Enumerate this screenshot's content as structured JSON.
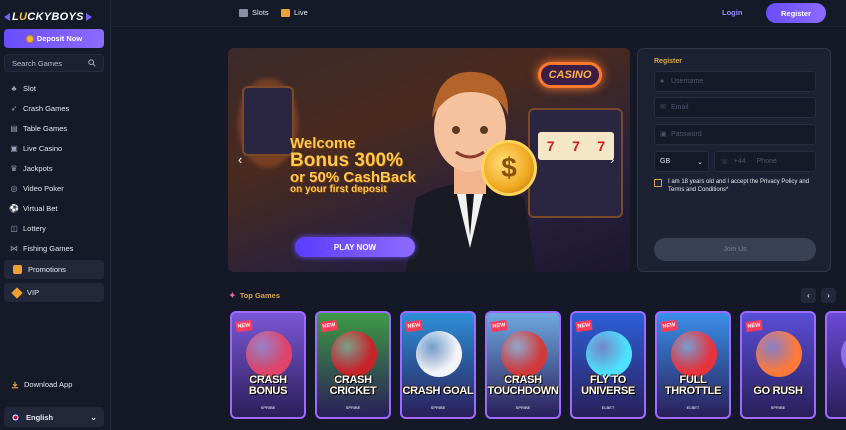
{
  "sidebar": {
    "logo_pre": "L",
    "logo_accent": "U",
    "logo_rest": "CKYBOYS",
    "deposit_label": "Deposit Now",
    "search_placeholder": "Search Games",
    "items": [
      {
        "label": "Slot",
        "icon": "cherry-icon"
      },
      {
        "label": "Crash Games",
        "icon": "rocket-icon"
      },
      {
        "label": "Table Games",
        "icon": "table-icon"
      },
      {
        "label": "Live Casino",
        "icon": "cards-icon"
      },
      {
        "label": "Jackpots",
        "icon": "trophy-icon"
      },
      {
        "label": "Video Poker",
        "icon": "chip-icon"
      },
      {
        "label": "Virtual Bet",
        "icon": "ball-icon"
      },
      {
        "label": "Lottery",
        "icon": "ticket-icon"
      },
      {
        "label": "Fishing Games",
        "icon": "fish-icon"
      }
    ],
    "promotions_label": "Promotions",
    "vip_label": "VIP",
    "download_label": "Download App",
    "language_label": "English"
  },
  "topbar": {
    "tab_slots": "Slots",
    "tab_live": "Live",
    "login_label": "Login",
    "register_label": "Register"
  },
  "banner": {
    "sign": "CASINO",
    "line1": "Welcome",
    "line2": "Bonus 300%",
    "line3": "or 50% CashBack",
    "line4": "on your first deposit",
    "coin_symbol": "$",
    "play_label": "PLAY NOW"
  },
  "register_form": {
    "title": "Register",
    "username_placeholder": "Username",
    "email_placeholder": "Email",
    "password_placeholder": "Password",
    "country_value": "GB",
    "phone_code": "+44",
    "phone_placeholder": "Phone",
    "agree_text": "I am 18 years old and I accept the Privacy Policy and Terms and Conditions*",
    "join_label": "Join Us"
  },
  "top_games": {
    "title": "Top Games",
    "badge": "NEW",
    "games": [
      {
        "name": "CRASH BONUS",
        "brand": "SPRIBE",
        "bg": "#7b57d6",
        "art": "#e0426a"
      },
      {
        "name": "CRASH CRICKET",
        "brand": "SPRIBE",
        "bg": "#3f9a45",
        "art": "#c8222a"
      },
      {
        "name": "CRASH GOAL",
        "brand": "SPRIBE",
        "bg": "#2f8fd8",
        "art": "#f2f4f8"
      },
      {
        "name": "CRASH TOUCHDOWN",
        "brand": "SPRIBE",
        "bg": "#6fa8e0",
        "art": "#d23a3a"
      },
      {
        "name": "FLY TO UNIVERSE",
        "brand": "ELBET",
        "bg": "#2d5fd8",
        "art": "#4ee0ff"
      },
      {
        "name": "FULL THROTTLE",
        "brand": "ELBET",
        "bg": "#3a8fe8",
        "art": "#e8323c"
      },
      {
        "name": "GO RUSH",
        "brand": "SPRIBE",
        "bg": "#5a4ed6",
        "art": "#ff7a3a"
      },
      {
        "name": "",
        "brand": "",
        "bg": "#6b4ad6",
        "art": "#8a6bff"
      }
    ]
  }
}
